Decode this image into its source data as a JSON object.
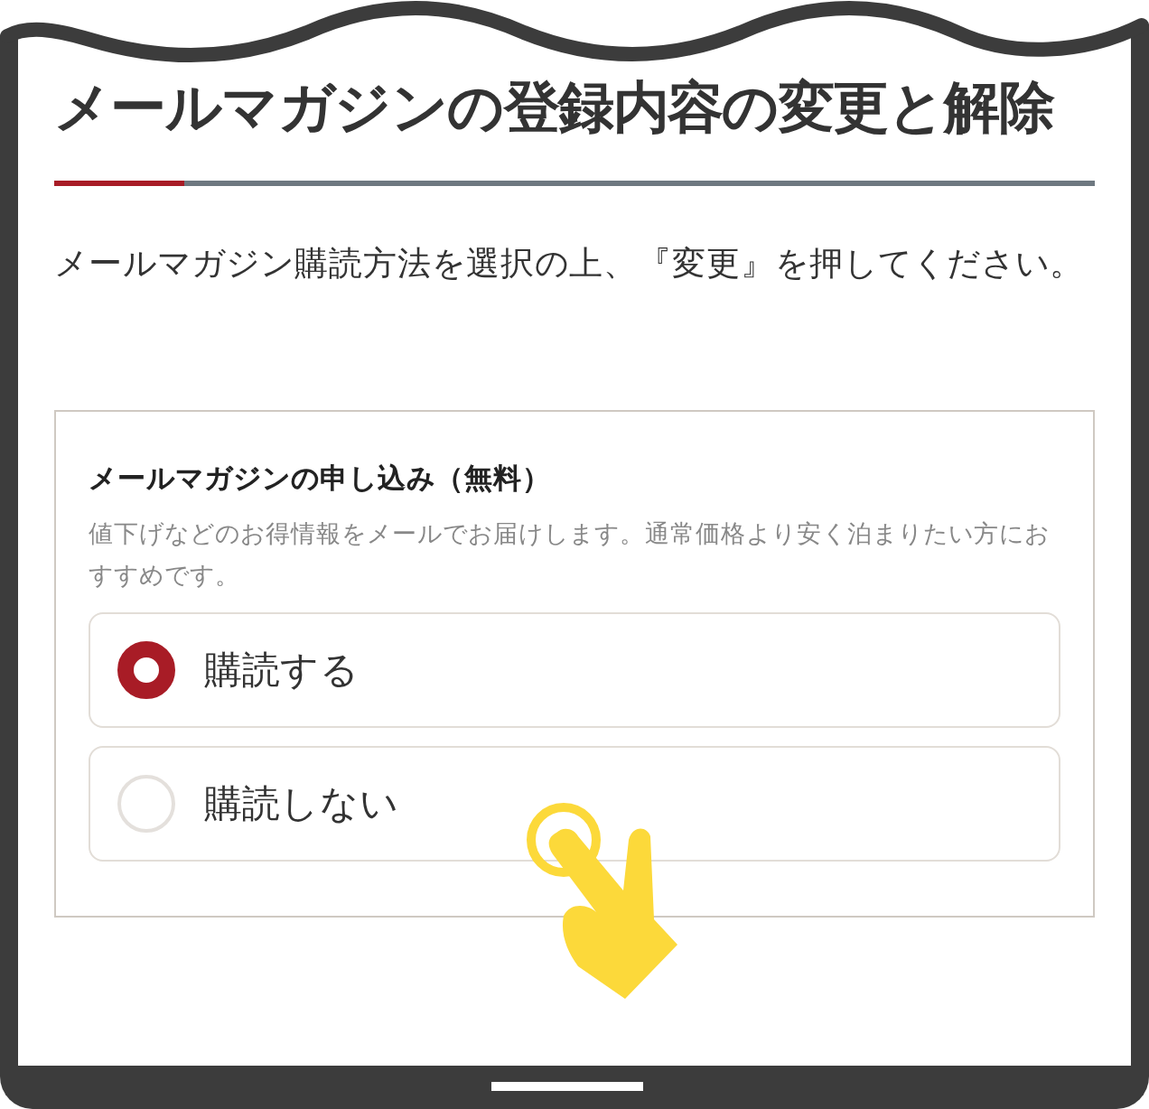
{
  "title": "メールマガジンの登録内容の変更と解除",
  "instruction": "メールマガジン購読方法を選択の上、『変更』を押してください。",
  "card": {
    "heading": "メールマガジンの申し込み（無料）",
    "description": "値下げなどのお得情報をメールでお届けします。通常価格より安く泊まりたい方におすすめです。",
    "options": [
      {
        "label": "購読する",
        "selected": true
      },
      {
        "label": "購読しない",
        "selected": false
      }
    ]
  }
}
